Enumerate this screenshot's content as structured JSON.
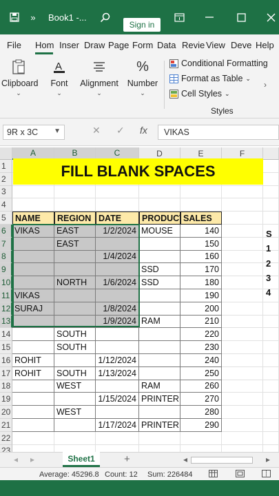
{
  "titlebar": {
    "file_title": "Book1 -...",
    "signin_label": "Sign in",
    "overflow": "»"
  },
  "tabs": [
    "File",
    "Hom",
    "Inser",
    "Draw",
    "Page",
    "Form",
    "Data",
    "Revie",
    "View",
    "Deve",
    "Help"
  ],
  "ribbon": {
    "clipboard": "Clipboard",
    "font": "Font",
    "alignment": "Alignment",
    "number": "Number",
    "number_symbol": "%",
    "conditional": "Conditional Formatting",
    "format_table": "Format as Table",
    "cell_styles": "Cell Styles",
    "styles_group": "Styles"
  },
  "formula_bar": {
    "name_box": "9R x 3C",
    "fx": "fx",
    "value": "VIKAS"
  },
  "grid": {
    "columns": [
      "A",
      "B",
      "C",
      "D",
      "E",
      "F"
    ],
    "rows": [
      "1",
      "2",
      "3",
      "4",
      "5",
      "6",
      "7",
      "8",
      "9",
      "10",
      "11",
      "12",
      "13",
      "14",
      "15",
      "16",
      "17",
      "18",
      "19",
      "20",
      "21",
      "22",
      "23"
    ],
    "title": "FILL BLANK SPACES",
    "headers": [
      "NAME",
      "REGION",
      "DATE",
      "PRODUCT",
      "SALES"
    ],
    "data": [
      [
        "VIKAS",
        "EAST",
        "1/2/2024",
        "MOUSE",
        "140"
      ],
      [
        "",
        "EAST",
        "",
        "",
        "150"
      ],
      [
        "",
        "",
        "1/4/2024",
        "",
        "160"
      ],
      [
        "",
        "",
        "",
        "SSD",
        "170"
      ],
      [
        "",
        "NORTH",
        "1/6/2024",
        "SSD",
        "180"
      ],
      [
        "VIKAS",
        "",
        "",
        "",
        "190"
      ],
      [
        "SURAJ",
        "",
        "1/8/2024",
        "",
        "200"
      ],
      [
        "",
        "",
        "1/9/2024",
        "RAM",
        "210"
      ],
      [
        "",
        "SOUTH",
        "",
        "",
        "220"
      ],
      [
        "",
        "SOUTH",
        "",
        "",
        "230"
      ],
      [
        "ROHIT",
        "",
        "1/12/2024",
        "",
        "240"
      ],
      [
        "ROHIT",
        "SOUTH",
        "1/13/2024",
        "",
        "250"
      ],
      [
        "",
        "WEST",
        "",
        "RAM",
        "260"
      ],
      [
        "",
        "",
        "1/15/2024",
        "PRINTER",
        "270"
      ],
      [
        "",
        "WEST",
        "",
        "",
        "280"
      ],
      [
        "",
        "",
        "1/17/2024",
        "PRINTER",
        "290"
      ]
    ],
    "side_cells": [
      "S",
      "1",
      "2",
      "3",
      "4"
    ]
  },
  "sheet": {
    "tab_name": "Sheet1",
    "add": "+"
  },
  "status": {
    "average": "Average: 45296.8",
    "count": "Count: 12",
    "sum": "Sum: 226484"
  },
  "colors": {
    "excel_green": "#1e7145",
    "title_fill": "#ffff00",
    "header_fill": "#fde9a9",
    "selection_fill": "#c8c8c8"
  }
}
